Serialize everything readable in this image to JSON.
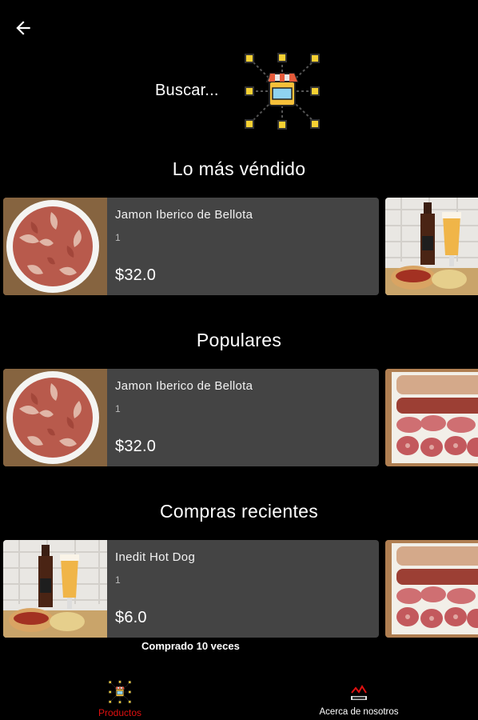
{
  "header": {
    "back_icon": "arrow-left-icon",
    "search_label": "Buscar...",
    "store_icon": "store-network-icon"
  },
  "colors": {
    "background": "#000000",
    "card": "#444444",
    "active_nav": "#e01010",
    "icon_yellow": "#f5d033"
  },
  "sections": [
    {
      "title": "Lo más véndido",
      "product": {
        "name": "Jamon Iberico de Bellota",
        "quantity": "1",
        "price": "$32.0",
        "image": "sliced-ham-plate"
      },
      "side_image": "beer-and-hotdog"
    },
    {
      "title": "Populares",
      "product": {
        "name": "Jamon Iberico de Bellota",
        "quantity": "1",
        "price": "$32.0",
        "image": "sliced-ham-plate"
      },
      "side_image": "charcuterie-board"
    },
    {
      "title": "Compras recientes",
      "product": {
        "name": "Inedit Hot Dog",
        "quantity": "1",
        "price": "$6.0",
        "image": "beer-and-hotdog"
      },
      "side_image": "charcuterie-board",
      "bought_label": "Comprado 10 veces"
    }
  ],
  "bottom_nav": [
    {
      "label": "Productos",
      "icon": "store-network-icon",
      "active": true
    },
    {
      "label": "Acerca de nosotros",
      "icon": "logo-icon",
      "active": false
    }
  ]
}
